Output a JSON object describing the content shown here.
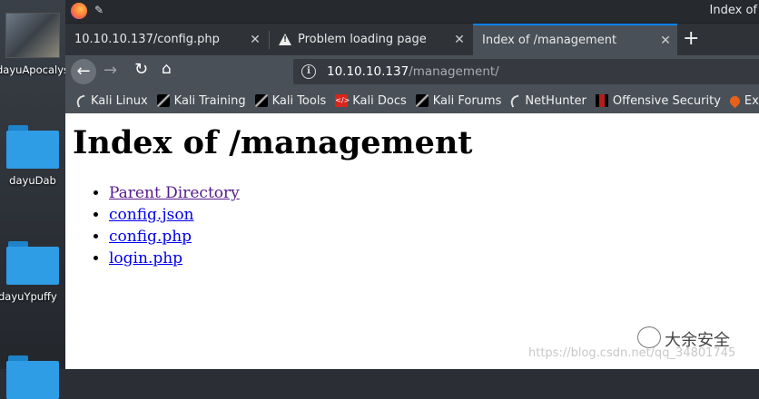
{
  "desktop": {
    "items": [
      {
        "label": "dayuApocalyse"
      },
      {
        "label": "dayuDab"
      },
      {
        "label": "dayuYpuffy"
      }
    ]
  },
  "window": {
    "title": "Index of"
  },
  "tabs": [
    {
      "label": "10.10.10.137/config.php"
    },
    {
      "label": "Problem loading page"
    },
    {
      "label": "Index of /management"
    }
  ],
  "url": {
    "host": "10.10.10.137",
    "path": "/management/"
  },
  "bookmarks": [
    {
      "label": "Kali Linux",
      "icon": "kali-icon"
    },
    {
      "label": "Kali Training",
      "icon": "kali-dragon-icon"
    },
    {
      "label": "Kali Tools",
      "icon": "kali-dragon-icon"
    },
    {
      "label": "Kali Docs",
      "icon": "kali-docs-icon"
    },
    {
      "label": "Kali Forums",
      "icon": "kali-dragon-icon"
    },
    {
      "label": "NetHunter",
      "icon": "kali-icon"
    },
    {
      "label": "Offensive Security",
      "icon": "offsec-icon"
    },
    {
      "label": "Exp",
      "icon": "exploit-db-icon"
    }
  ],
  "page": {
    "title": "Index of /management",
    "entries": [
      {
        "label": "Parent Directory"
      },
      {
        "label": "config.json"
      },
      {
        "label": "config.php"
      },
      {
        "label": "login.php"
      }
    ]
  },
  "watermark": {
    "text": "大余安全",
    "url": "https://blog.csdn.net/qq_34801745"
  },
  "colors": {
    "link": "#0000ee",
    "visited": "#551a8b",
    "active_tab_accent": "#0a84ff"
  }
}
